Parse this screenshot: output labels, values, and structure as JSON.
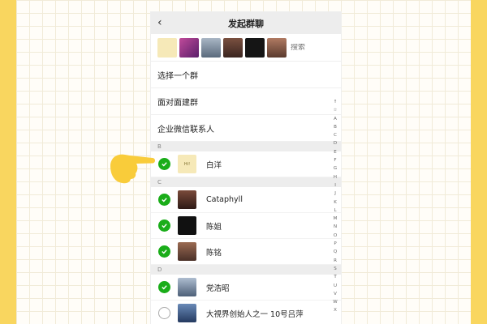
{
  "header": {
    "back_icon": "chevron-left-icon",
    "title": "发起群聊"
  },
  "selected_bar": {
    "selected_avatars": [
      {
        "name": "avatar-baiyang-logo",
        "color": "#f6e9b8"
      },
      {
        "name": "avatar-flowers",
        "color": "#9b3a8a"
      },
      {
        "name": "avatar-tower",
        "color": "#6b7a8c"
      },
      {
        "name": "avatar-woman-1",
        "color": "#5a3b2e"
      },
      {
        "name": "avatar-dark",
        "color": "#151515"
      },
      {
        "name": "avatar-woman-2",
        "color": "#8a5a48"
      }
    ],
    "search_placeholder": "搜索"
  },
  "menu": {
    "select_group": "选择一个群",
    "face_to_face": "面对面建群",
    "enterprise_contacts": "企业微信联系人"
  },
  "sections": {
    "b": "B",
    "c": "C",
    "d": "D"
  },
  "contacts": [
    {
      "name": "白洋",
      "checked": true,
      "avatar_color": "#f6e9b8",
      "avatar_text": "Hi!"
    },
    {
      "name": "Cataphyll",
      "checked": true,
      "avatar_color": "#4a2a22"
    },
    {
      "name": "陈姐",
      "checked": true,
      "avatar_color": "#111111"
    },
    {
      "name": "陈铭",
      "checked": true,
      "avatar_color": "#6b4a3a"
    },
    {
      "name": "党浩昭",
      "checked": true,
      "avatar_color": "#5b6f86"
    },
    {
      "name": "大視界创始人之一 10号吕萍",
      "checked": false,
      "avatar_color": "#3a5a8a"
    }
  ],
  "alphabet_index": [
    "↑",
    "☆",
    "A",
    "B",
    "C",
    "D",
    "E",
    "F",
    "G",
    "H",
    "I",
    "J",
    "K",
    "L",
    "M",
    "N",
    "O",
    "P",
    "Q",
    "R",
    "S",
    "T",
    "U",
    "V",
    "W",
    "X"
  ],
  "colors": {
    "check_green": "#1aad19",
    "pointer_yellow": "#f9cc3a"
  }
}
